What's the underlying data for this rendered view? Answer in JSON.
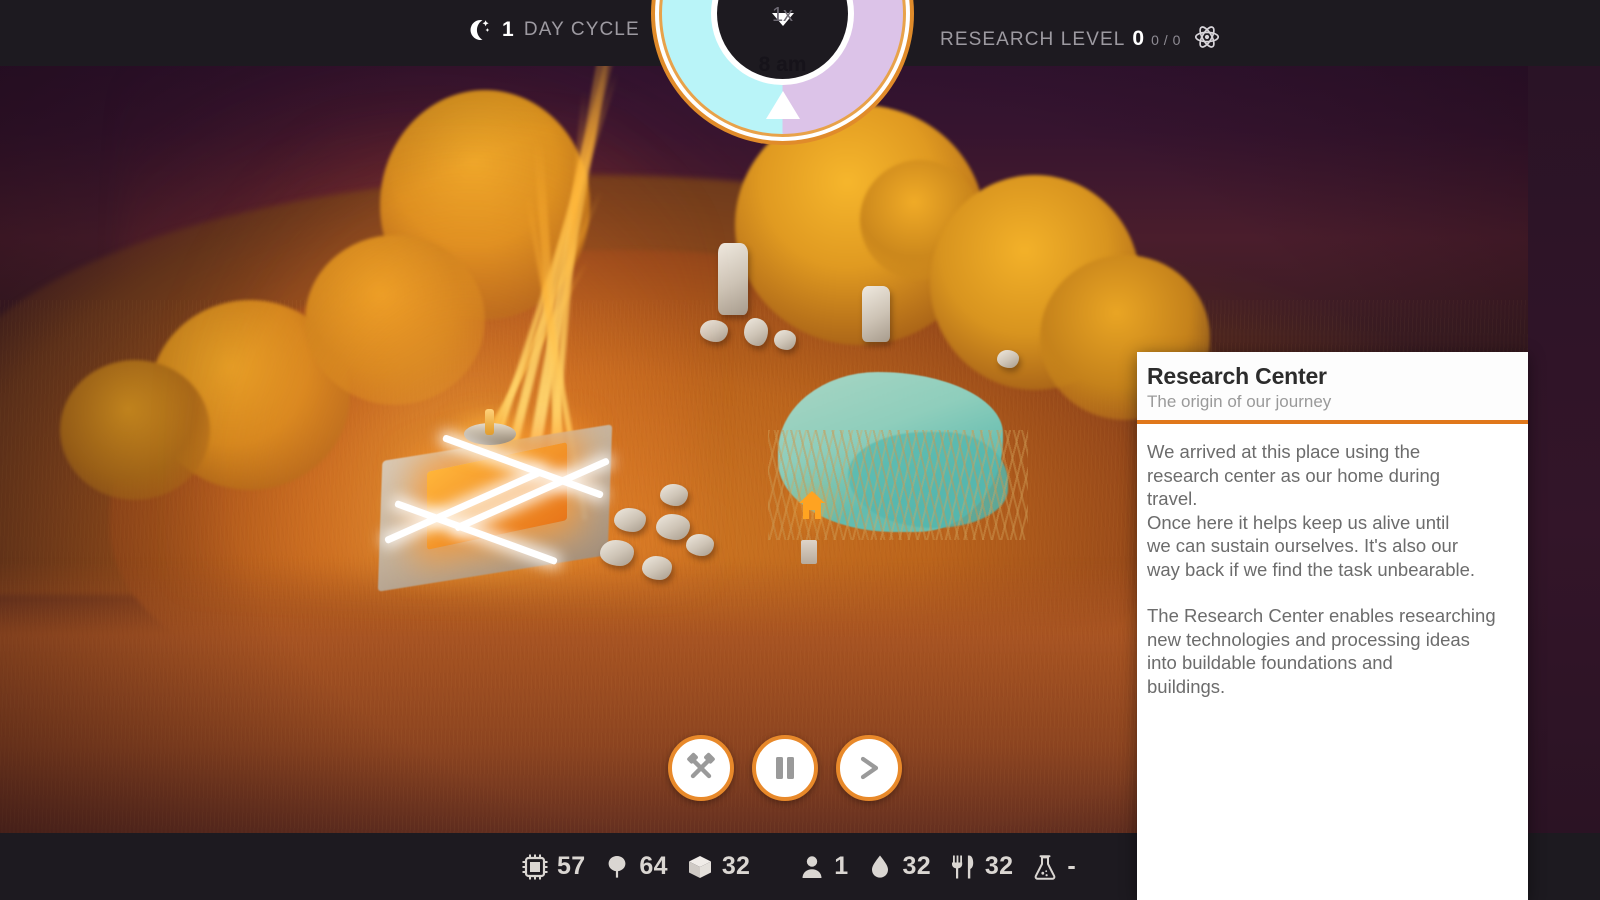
{
  "topbar": {
    "moon_icon": "crescent-moon-icon",
    "day_number": "1",
    "day_label": "DAY CYCLE",
    "research_label": "RESEARCH LEVEL",
    "research_level": "0",
    "research_progress": "0 / 0",
    "atom_icon": "atom-icon"
  },
  "clock": {
    "speed": "1x",
    "time": "8 am",
    "day_color": "#b9f4f8",
    "night_color": "#dcc3e8",
    "ring_color": "#e08b2a"
  },
  "controls": [
    {
      "name": "build-button",
      "icon": "crossed-hammers-icon"
    },
    {
      "name": "pause-button",
      "icon": "pause-icon"
    },
    {
      "name": "fast-forward-button",
      "icon": "play-forward-icon"
    }
  ],
  "resources": {
    "left_group": [
      {
        "name": "chip-resource",
        "icon": "microchip-icon",
        "value": "57"
      },
      {
        "name": "wood-resource",
        "icon": "tree-icon",
        "value": "64"
      },
      {
        "name": "crate-resource",
        "icon": "cube-icon",
        "value": "32"
      }
    ],
    "right_group": [
      {
        "name": "population-resource",
        "icon": "person-icon",
        "value": "1"
      },
      {
        "name": "water-resource",
        "icon": "water-droplet-icon",
        "value": "32"
      },
      {
        "name": "food-resource",
        "icon": "fork-knife-icon",
        "value": "32"
      },
      {
        "name": "science-resource",
        "icon": "flask-icon",
        "value": "-"
      }
    ]
  },
  "panel": {
    "title": "Research Center",
    "subtitle": "The origin of our journey",
    "accent_color": "#e0771b",
    "paragraph_1": "We arrived at this place using the\nresearch center as our home during\ntravel.\nOnce here it helps keep us alive until\nwe can sustain ourselves. It's also our\nway back if we find the task unbearable.",
    "paragraph_2": "The Research Center enables researching\nnew technologies and processing ideas\ninto buildable foundations and\nbuildings."
  },
  "scene": {
    "name": "isometric-colony-world",
    "build_site_label": "research-center-construction-site",
    "pond_label": "pond",
    "home_marker_label": "home-marker"
  }
}
